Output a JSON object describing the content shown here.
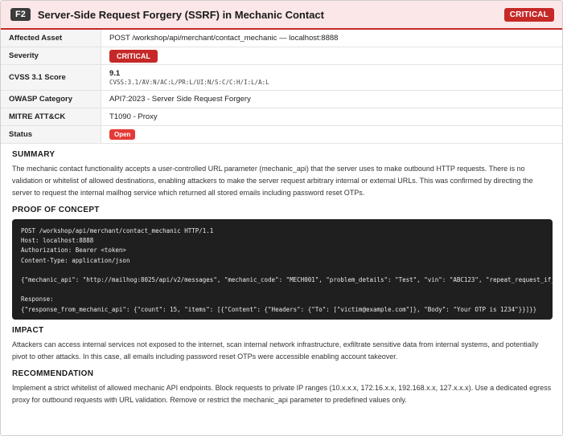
{
  "header": {
    "finding_id": "F2",
    "title": "Server-Side Request Forgery (SSRF) in Mechanic Contact",
    "severity_badge": "CRITICAL"
  },
  "meta": {
    "affected_asset_label": "Affected Asset",
    "affected_asset_value": "POST /workshop/api/merchant/contact_mechanic — localhost:8888",
    "severity_label": "Severity",
    "severity_value": "CRITICAL",
    "cvss_label": "CVSS 3.1 Score",
    "cvss_score": "9.1",
    "cvss_vector": "CVSS:3.1/AV:N/AC:L/PR:L/UI:N/S:C/C:H/I:L/A:L",
    "owasp_label": "OWASP Category",
    "owasp_value": "API7:2023 - Server Side Request Forgery",
    "mitre_label": "MITRE ATT&CK",
    "mitre_value": "T1090 - Proxy",
    "status_label": "Status",
    "status_value": "Open"
  },
  "summary": {
    "heading": "SUMMARY",
    "text": "The mechanic contact functionality accepts a user-controlled URL parameter (mechanic_api) that the server uses to make outbound HTTP requests. There is no validation or whitelist of allowed destinations, enabling attackers to make the server request arbitrary internal or external URLs. This was confirmed by directing the server to request the internal mailhog service which returned all stored emails including password reset OTPs."
  },
  "poc": {
    "heading": "PROOF OF CONCEPT",
    "code": "POST /workshop/api/merchant/contact_mechanic HTTP/1.1\nHost: localhost:8888\nAuthorization: Bearer <token>\nContent-Type: application/json\n\n{\"mechanic_api\": \"http://mailhog:8025/api/v2/messages\", \"mechanic_code\": \"MECH001\", \"problem_details\": \"Test\", \"vin\": \"ABC123\", \"repeat_request_if_failed\": false}\n\nResponse:\n{\"response_from_mechanic_api\": {\"count\": 15, \"items\": [{\"Content\": {\"Headers\": {\"To\": [\"victim@example.com\"]}, \"Body\": \"Your OTP is 1234\"}}]}}"
  },
  "impact": {
    "heading": "IMPACT",
    "text": "Attackers can access internal services not exposed to the internet, scan internal network infrastructure, exfiltrate sensitive data from internal systems, and potentially pivot to other attacks. In this case, all emails including password reset OTPs were accessible enabling account takeover."
  },
  "recommendation": {
    "heading": "RECOMMENDATION",
    "text": "Implement a strict whitelist of allowed mechanic API endpoints. Block requests to private IP ranges (10.x.x.x, 172.16.x.x, 192.168.x.x, 127.x.x.x). Use a dedicated egress proxy for outbound requests with URL validation. Remove or restrict the mechanic_api parameter to predefined values only."
  },
  "colors": {
    "critical": "#c62828",
    "open": "#e53935",
    "header_bg": "#fbe7e7",
    "code_bg": "#1f1f1f"
  }
}
